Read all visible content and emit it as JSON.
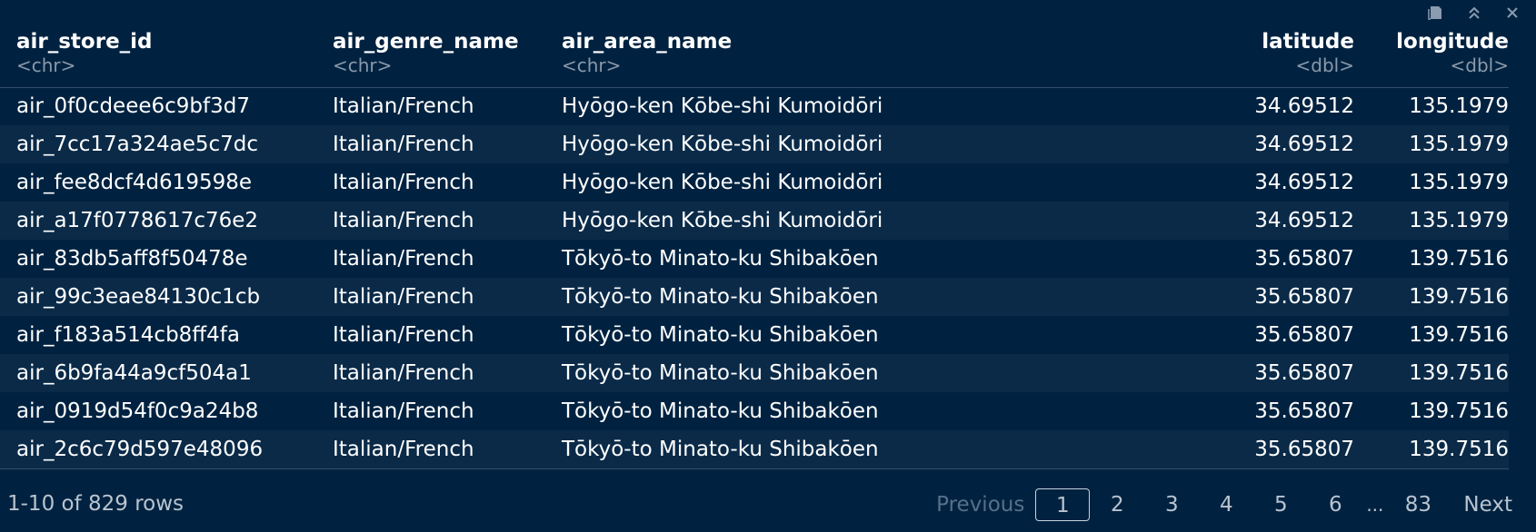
{
  "toolbar": {
    "icons": [
      "clear-console-icon",
      "collapse-icon",
      "close-icon"
    ]
  },
  "columns": [
    {
      "name": "air_store_id",
      "type": "<chr>"
    },
    {
      "name": "air_genre_name",
      "type": "<chr>"
    },
    {
      "name": "air_area_name",
      "type": "<chr>"
    },
    {
      "name": "latitude",
      "type": "<dbl>"
    },
    {
      "name": "longitude",
      "type": "<dbl>"
    }
  ],
  "rows": [
    [
      "air_0f0cdeee6c9bf3d7",
      "Italian/French",
      "Hyōgo-ken Kōbe-shi Kumoidōri",
      "34.69512",
      "135.1979"
    ],
    [
      "air_7cc17a324ae5c7dc",
      "Italian/French",
      "Hyōgo-ken Kōbe-shi Kumoidōri",
      "34.69512",
      "135.1979"
    ],
    [
      "air_fee8dcf4d619598e",
      "Italian/French",
      "Hyōgo-ken Kōbe-shi Kumoidōri",
      "34.69512",
      "135.1979"
    ],
    [
      "air_a17f0778617c76e2",
      "Italian/French",
      "Hyōgo-ken Kōbe-shi Kumoidōri",
      "34.69512",
      "135.1979"
    ],
    [
      "air_83db5aff8f50478e",
      "Italian/French",
      "Tōkyō-to Minato-ku Shibakōen",
      "35.65807",
      "139.7516"
    ],
    [
      "air_99c3eae84130c1cb",
      "Italian/French",
      "Tōkyō-to Minato-ku Shibakōen",
      "35.65807",
      "139.7516"
    ],
    [
      "air_f183a514cb8ff4fa",
      "Italian/French",
      "Tōkyō-to Minato-ku Shibakōen",
      "35.65807",
      "139.7516"
    ],
    [
      "air_6b9fa44a9cf504a1",
      "Italian/French",
      "Tōkyō-to Minato-ku Shibakōen",
      "35.65807",
      "139.7516"
    ],
    [
      "air_0919d54f0c9a24b8",
      "Italian/French",
      "Tōkyō-to Minato-ku Shibakōen",
      "35.65807",
      "139.7516"
    ],
    [
      "air_2c6c79d597e48096",
      "Italian/French",
      "Tōkyō-to Minato-ku Shibakōen",
      "35.65807",
      "139.7516"
    ]
  ],
  "footer": {
    "rows_info": "1-10 of 829 rows",
    "previous_label": "Previous",
    "pages": [
      "1",
      "2",
      "3",
      "4",
      "5",
      "6"
    ],
    "current_page": "1",
    "ellipsis": "...",
    "last_page": "83",
    "next_label": "Next"
  }
}
